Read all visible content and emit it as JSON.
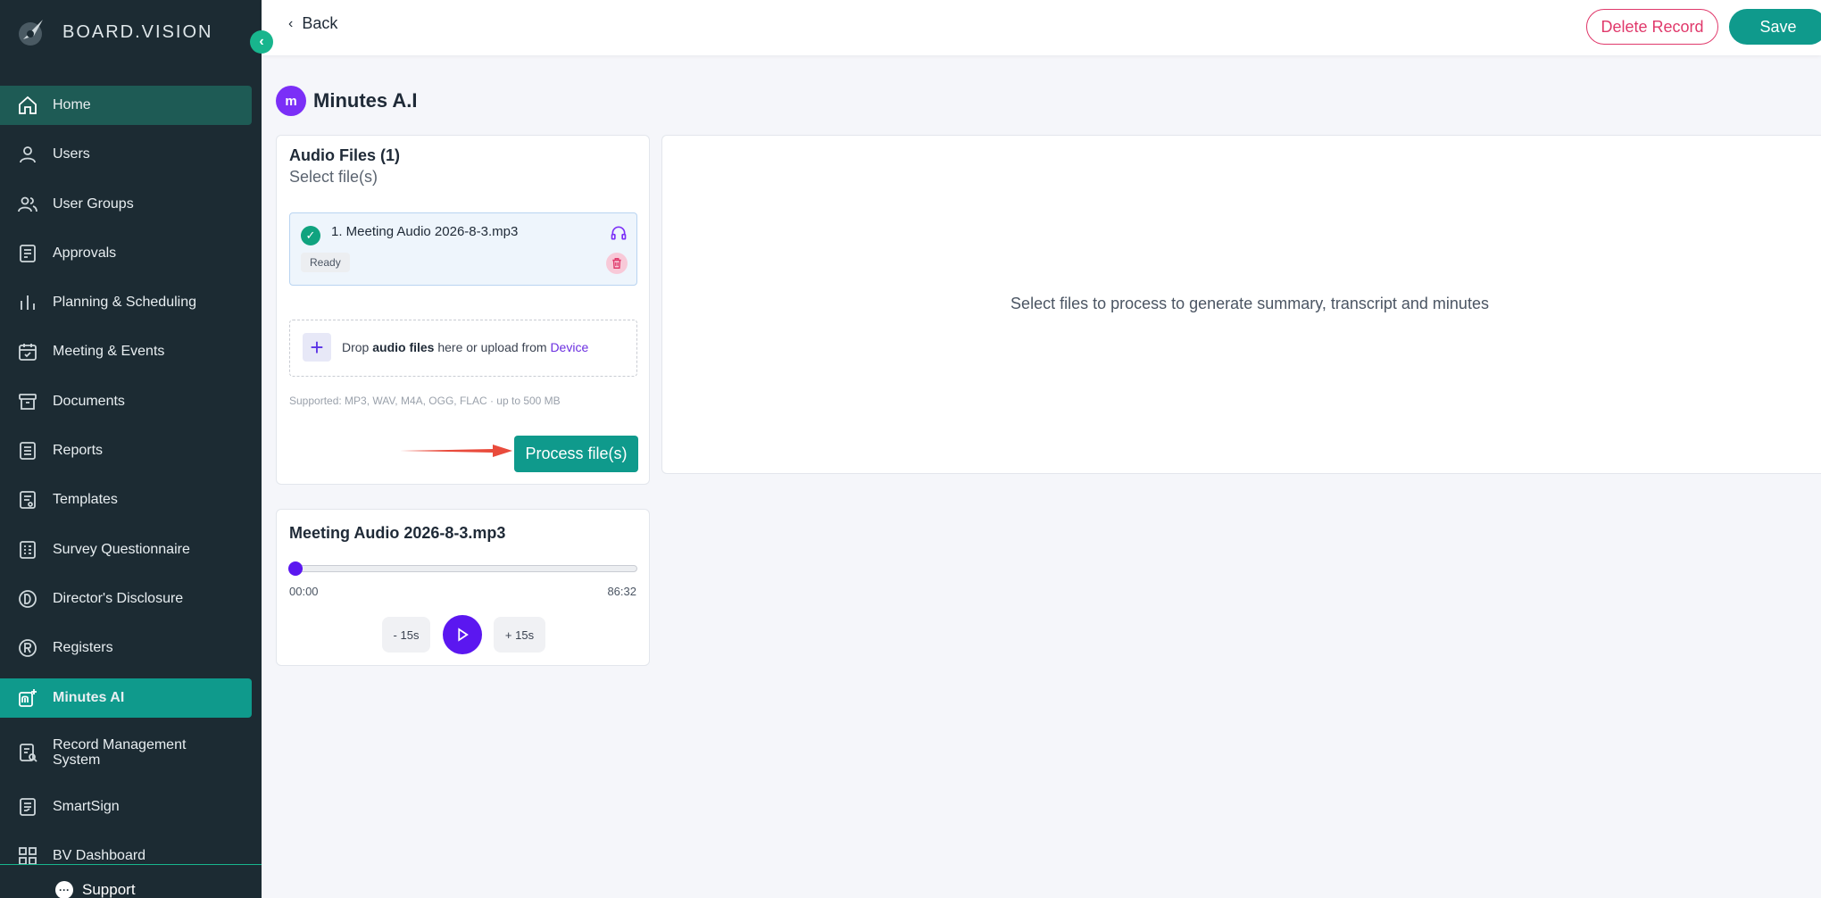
{
  "brand": {
    "name": "BOARD.VISION"
  },
  "sidebar": {
    "items": [
      {
        "label": "Home",
        "icon": "home-icon"
      },
      {
        "label": "Users",
        "icon": "user-icon"
      },
      {
        "label": "User Groups",
        "icon": "users-icon"
      },
      {
        "label": "Approvals",
        "icon": "document-check-icon"
      },
      {
        "label": "Planning & Scheduling",
        "icon": "bar-chart-icon"
      },
      {
        "label": "Meeting & Events",
        "icon": "calendar-check-icon"
      },
      {
        "label": "Documents",
        "icon": "archive-icon"
      },
      {
        "label": "Reports",
        "icon": "list-icon"
      },
      {
        "label": "Templates",
        "icon": "template-icon"
      },
      {
        "label": "Survey Questionnaire",
        "icon": "survey-icon"
      },
      {
        "label": "Director's Disclosure",
        "icon": "d-circle-icon"
      },
      {
        "label": "Registers",
        "icon": "r-circle-icon"
      },
      {
        "label": "Minutes AI",
        "icon": "minutes-ai-icon"
      },
      {
        "label": "Record Management System",
        "icon": "record-search-icon"
      },
      {
        "label": "SmartSign",
        "icon": "sign-icon"
      },
      {
        "label": "BV Dashboard",
        "icon": "grid-icon"
      }
    ],
    "support_label": "Support"
  },
  "topbar": {
    "back_label": "Back",
    "delete_label": "Delete Record",
    "save_label": "Save"
  },
  "page": {
    "title": "Minutes A.I",
    "title_mark": "m"
  },
  "audio_files": {
    "heading": "Audio Files (1)",
    "subheading": "Select file(s)",
    "files": [
      {
        "name": "1. Meeting Audio 2026-8-3.mp3",
        "status": "Ready"
      }
    ],
    "drop_prefix": "Drop ",
    "drop_bold": "audio files",
    "drop_middle": " here or upload from ",
    "drop_link": "Device",
    "supported": "Supported: MP3, WAV, M4A, OGG, FLAC · up to 500 MB",
    "process_label": "Process file(s)"
  },
  "player": {
    "title": "Meeting Audio 2026-8-3.mp3",
    "current_time": "00:00",
    "duration": "86:32",
    "progress": 0,
    "back_label": "- 15s",
    "forward_label": "+ 15s"
  },
  "result": {
    "message": "Select files to process to generate summary, transcript and minutes"
  },
  "colors": {
    "sidebar_bg": "#1c2b33",
    "accent": "#0f9a8c",
    "danger": "#e0396b",
    "purple": "#5b17f0"
  }
}
